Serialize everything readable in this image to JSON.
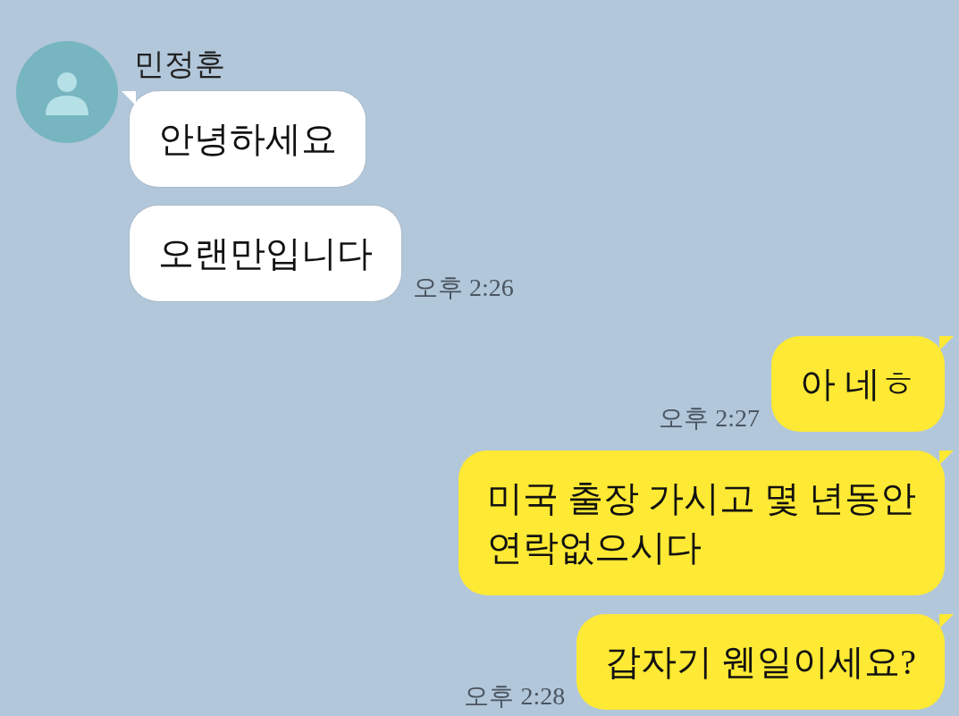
{
  "groups": [
    {
      "kind": "received",
      "name": "민정훈",
      "bubbles": [
        {
          "text": "안녕하세요",
          "tail": true
        },
        {
          "text": "오랜만입니다",
          "tail": false,
          "time": "오후 2:26"
        }
      ]
    },
    {
      "kind": "sent",
      "bubbles": [
        {
          "text": "아 네ㅎ",
          "tail": true,
          "time": "오후 2:27"
        },
        {
          "text": "미국 출장 가시고 몇 년동안\n연락없으시다",
          "tail": true
        },
        {
          "text": "갑자기 웬일이세요?",
          "tail": true,
          "time": "오후 2:28"
        }
      ]
    }
  ]
}
